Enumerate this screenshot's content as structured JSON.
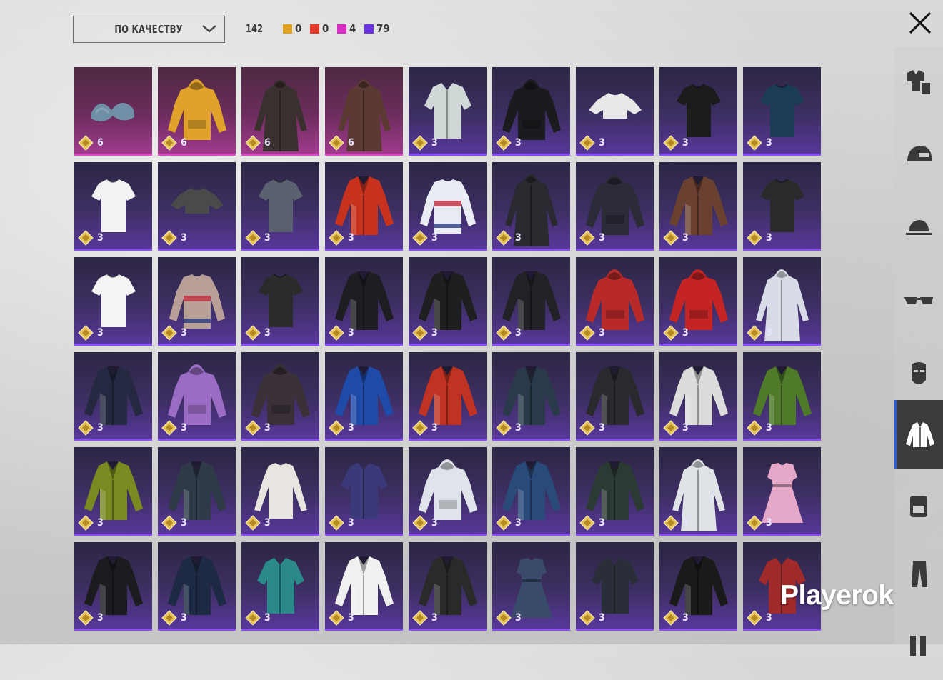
{
  "header": {
    "sort_label": "ПО КАЧЕСТВУ",
    "total_count": "142",
    "quality_counts": [
      {
        "color": "#e0a020",
        "value": "0"
      },
      {
        "color": "#e23b2e",
        "value": "0"
      },
      {
        "color": "#d62ec2",
        "value": "4"
      },
      {
        "color": "#6a35e0",
        "value": "79"
      }
    ]
  },
  "items": [
    {
      "price": "6",
      "rarity": "legendary",
      "icon": "bikini-top-icon",
      "color": "#6f8fa6"
    },
    {
      "price": "6",
      "rarity": "legendary",
      "icon": "hoodie-icon",
      "color": "#e0a22a"
    },
    {
      "price": "6",
      "rarity": "legendary",
      "icon": "longcoat-icon",
      "color": "#3a3030"
    },
    {
      "price": "6",
      "rarity": "legendary",
      "icon": "longcoat-icon",
      "color": "#5a3a32"
    },
    {
      "price": "3",
      "rarity": "epic",
      "icon": "shirt-icon",
      "color": "#cfd8d6"
    },
    {
      "price": "3",
      "rarity": "epic",
      "icon": "hoodie-icon",
      "color": "#1b1b1f"
    },
    {
      "price": "3",
      "rarity": "epic",
      "icon": "crop-top-icon",
      "color": "#e8e8e8"
    },
    {
      "price": "3",
      "rarity": "epic",
      "icon": "tshirt-icon",
      "color": "#1c1c1c"
    },
    {
      "price": "3",
      "rarity": "epic",
      "icon": "tshirt-icon",
      "color": "#1a3c55"
    },
    {
      "price": "3",
      "rarity": "epic",
      "icon": "tshirt-icon",
      "color": "#f2f2f2"
    },
    {
      "price": "3",
      "rarity": "epic",
      "icon": "crop-top-icon",
      "color": "#4a4a4a"
    },
    {
      "price": "3",
      "rarity": "epic",
      "icon": "tshirt-icon",
      "color": "#5a6270"
    },
    {
      "price": "3",
      "rarity": "epic",
      "icon": "jacket-icon",
      "color": "#c7321e"
    },
    {
      "price": "3",
      "rarity": "epic",
      "icon": "sweater-icon",
      "color": "#e9ecf2"
    },
    {
      "price": "3",
      "rarity": "epic",
      "icon": "longcoat-icon",
      "color": "#2a2a30"
    },
    {
      "price": "3",
      "rarity": "epic",
      "icon": "hoodie-icon",
      "color": "#2c2c38"
    },
    {
      "price": "3",
      "rarity": "epic",
      "icon": "jacket-icon",
      "color": "#6a4030"
    },
    {
      "price": "3",
      "rarity": "epic",
      "icon": "tshirt-icon",
      "color": "#2a2a2a"
    },
    {
      "price": "3",
      "rarity": "epic",
      "icon": "tshirt-icon",
      "color": "#f4f4f4"
    },
    {
      "price": "3",
      "rarity": "epic",
      "icon": "sweater-icon",
      "color": "#b8a098"
    },
    {
      "price": "3",
      "rarity": "epic",
      "icon": "tshirt-icon",
      "color": "#2b2b2b"
    },
    {
      "price": "3",
      "rarity": "epic",
      "icon": "jacket-icon",
      "color": "#1e1e22"
    },
    {
      "price": "3",
      "rarity": "epic",
      "icon": "jacket-icon",
      "color": "#1f1f22"
    },
    {
      "price": "3",
      "rarity": "epic",
      "icon": "jacket-icon",
      "color": "#222226"
    },
    {
      "price": "3",
      "rarity": "epic",
      "icon": "hoodie-icon",
      "color": "#b82a2a"
    },
    {
      "price": "3",
      "rarity": "epic",
      "icon": "hoodie-icon",
      "color": "#c42424"
    },
    {
      "price": "3",
      "rarity": "epic",
      "icon": "longcoat-icon",
      "color": "#d8dce6"
    },
    {
      "price": "3",
      "rarity": "epic",
      "icon": "jacket-icon",
      "color": "#242840"
    },
    {
      "price": "3",
      "rarity": "epic",
      "icon": "hoodie-icon",
      "color": "#9a6cc4"
    },
    {
      "price": "3",
      "rarity": "epic",
      "icon": "hoodie-icon",
      "color": "#3a3038"
    },
    {
      "price": "3",
      "rarity": "epic",
      "icon": "jacket-icon",
      "color": "#1e4aa8"
    },
    {
      "price": "3",
      "rarity": "epic",
      "icon": "jacket-icon",
      "color": "#c03222"
    },
    {
      "price": "3",
      "rarity": "epic",
      "icon": "jacket-icon",
      "color": "#2a3a4a"
    },
    {
      "price": "3",
      "rarity": "epic",
      "icon": "jacket-icon",
      "color": "#2a2a2e"
    },
    {
      "price": "3",
      "rarity": "epic",
      "icon": "jacket-icon",
      "color": "#dcdcdc"
    },
    {
      "price": "3",
      "rarity": "epic",
      "icon": "jacket-icon",
      "color": "#4e7a2a"
    },
    {
      "price": "3",
      "rarity": "epic",
      "icon": "jacket-icon",
      "color": "#7a8a20"
    },
    {
      "price": "3",
      "rarity": "epic",
      "icon": "jacket-icon",
      "color": "#2e3a48"
    },
    {
      "price": "3",
      "rarity": "epic",
      "icon": "longsleeve-icon",
      "color": "#e8e4e0"
    },
    {
      "price": "3",
      "rarity": "epic",
      "icon": "shirt-icon",
      "color": "#3a3a7a"
    },
    {
      "price": "3",
      "rarity": "epic",
      "icon": "hoodie-icon",
      "color": "#dfe3ea"
    },
    {
      "price": "3",
      "rarity": "epic",
      "icon": "jacket-icon",
      "color": "#2a4a7a"
    },
    {
      "price": "3",
      "rarity": "epic",
      "icon": "jacket-icon",
      "color": "#2c3a34"
    },
    {
      "price": "3",
      "rarity": "epic",
      "icon": "longcoat-icon",
      "color": "#dfe2e6"
    },
    {
      "price": "3",
      "rarity": "epic",
      "icon": "dress-icon",
      "color": "#e6a8c8"
    },
    {
      "price": "3",
      "rarity": "epic",
      "icon": "jacket-icon",
      "color": "#1c1c20"
    },
    {
      "price": "3",
      "rarity": "epic",
      "icon": "jacket-icon",
      "color": "#1e2a44"
    },
    {
      "price": "3",
      "rarity": "epic",
      "icon": "shirt-icon",
      "color": "#2a8a8a"
    },
    {
      "price": "3",
      "rarity": "epic",
      "icon": "jacket-icon",
      "color": "#f0f0f0"
    },
    {
      "price": "3",
      "rarity": "epic",
      "icon": "jacket-icon",
      "color": "#2a2a2a"
    },
    {
      "price": "3",
      "rarity": "epic",
      "icon": "dress-icon",
      "color": "#3a4a6a"
    },
    {
      "price": "3",
      "rarity": "epic",
      "icon": "shirt-icon",
      "color": "#2a2e38"
    },
    {
      "price": "3",
      "rarity": "epic",
      "icon": "jacket-icon",
      "color": "#1a1a1a"
    },
    {
      "price": "3",
      "rarity": "epic",
      "icon": "shirt-icon",
      "color": "#a02a2a"
    }
  ],
  "side_nav": [
    {
      "icon": "outfit-icon",
      "active": false
    },
    {
      "icon": "helmet-icon",
      "active": false
    },
    {
      "icon": "cap-icon",
      "active": false
    },
    {
      "icon": "glasses-icon",
      "active": false
    },
    {
      "icon": "mask-icon",
      "active": false
    },
    {
      "icon": "jacket-icon",
      "active": true
    },
    {
      "icon": "backpack-icon",
      "active": false
    },
    {
      "icon": "pants-icon",
      "active": false
    },
    {
      "icon": "shoes-icon",
      "active": false
    }
  ],
  "watermark": "Playerok"
}
